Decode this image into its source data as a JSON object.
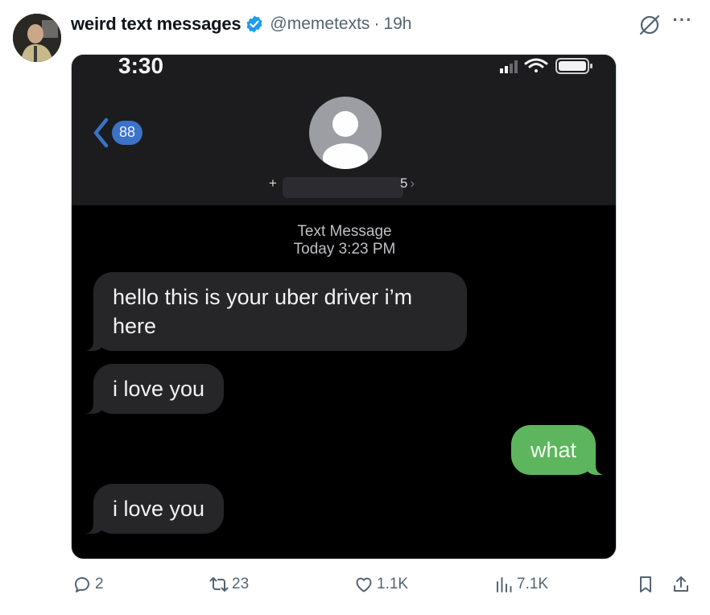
{
  "tweet": {
    "display_name": "weird text messages",
    "handle": "@memetexts",
    "separator": "·",
    "time": "19h",
    "verified_color": "#1d9bf0"
  },
  "phone": {
    "clock": "3:30",
    "back_badge": "88",
    "contact_prefix": "+",
    "contact_suffix": "5",
    "contact_chevron": "›",
    "meta_label": "Text Message",
    "meta_time": "Today 3:23 PM",
    "messages": [
      {
        "direction": "incoming",
        "text": "hello this is your uber driver i’m here"
      },
      {
        "direction": "incoming",
        "text": "i love you"
      },
      {
        "direction": "outgoing",
        "text": "what"
      },
      {
        "direction": "incoming",
        "text": "i love you"
      }
    ],
    "colors": {
      "incoming_bubble": "#262629",
      "outgoing_bubble": "#5db55d",
      "badge": "#3a73c8"
    }
  },
  "actions": {
    "replies": "2",
    "retweets": "23",
    "likes": "1.1K",
    "views": "7.1K"
  },
  "icons": [
    "verified-badge-icon",
    "grok-icon",
    "more-icon",
    "reply-icon",
    "retweet-icon",
    "like-icon",
    "views-icon",
    "bookmark-icon",
    "share-icon",
    "back-chevron-icon",
    "signal-icon",
    "wifi-icon",
    "battery-icon",
    "contact-avatar-icon"
  ]
}
